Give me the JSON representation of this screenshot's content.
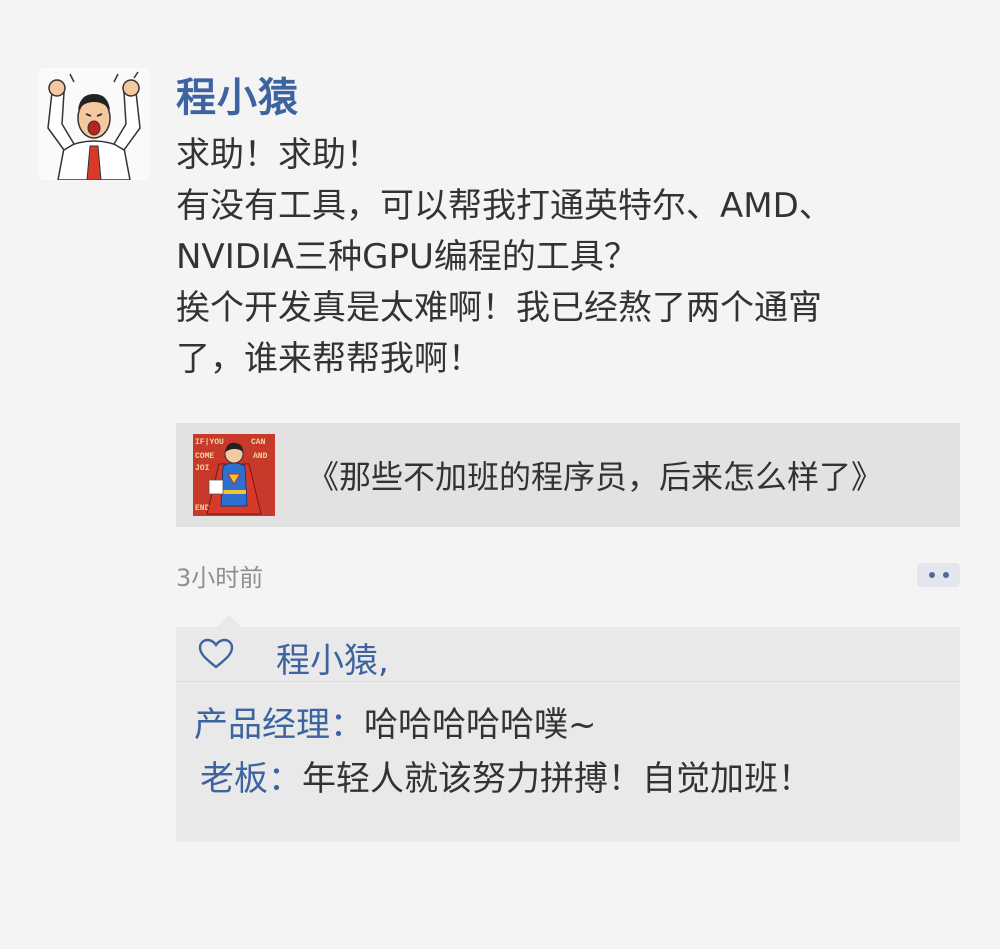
{
  "post": {
    "author": "程小猿",
    "lines": [
      "求助！求助！",
      "有没有工具，可以帮我打通英特尔、AMD、",
      "NVIDIA三种GPU编程的工具？",
      "挨个开发真是太难啊！我已经熬了两个通宵",
      "了，谁来帮帮我啊！"
    ],
    "time": "3小时前"
  },
  "link_card": {
    "title": "《那些不加班的程序员，后来怎么样了》",
    "thumb_text": "IF YOU CAN COME JOIN END"
  },
  "likes": {
    "names": "程小猿,"
  },
  "comments": [
    {
      "who": "产品经理",
      "colon": "：",
      "msg": "哈哈哈哈哈噗~"
    },
    {
      "who": "老板",
      "colon": "：",
      "msg": "年轻人就该努力拼搏！自觉加班！"
    }
  ]
}
